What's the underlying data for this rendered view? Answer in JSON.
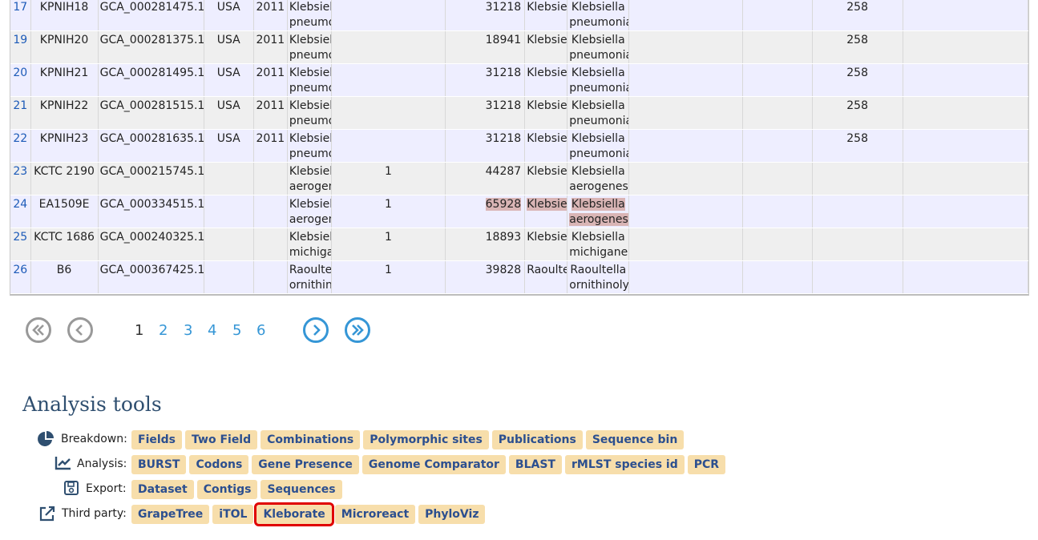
{
  "table": {
    "rows": [
      {
        "id": "17",
        "isolate": "KPNIH18",
        "assembly": "GCA_000281475.1",
        "country": "USA",
        "year": "2011",
        "species": "Klebsiella pneumoniae",
        "c7": "",
        "taxid": "31218",
        "genus": "Klebsiella",
        "species2": "Klebsiella pneumoniae",
        "c11": "",
        "c12": "",
        "st": "258"
      },
      {
        "id": "19",
        "isolate": "KPNIH20",
        "assembly": "GCA_000281375.1",
        "country": "USA",
        "year": "2011",
        "species": "Klebsiella pneumoniae",
        "c7": "",
        "taxid": "18941",
        "genus": "Klebsiella",
        "species2": "Klebsiella pneumoniae",
        "c11": "",
        "c12": "",
        "st": "258"
      },
      {
        "id": "20",
        "isolate": "KPNIH21",
        "assembly": "GCA_000281495.1",
        "country": "USA",
        "year": "2011",
        "species": "Klebsiella pneumoniae",
        "c7": "",
        "taxid": "31218",
        "genus": "Klebsiella",
        "species2": "Klebsiella pneumoniae",
        "c11": "",
        "c12": "",
        "st": "258"
      },
      {
        "id": "21",
        "isolate": "KPNIH22",
        "assembly": "GCA_000281515.1",
        "country": "USA",
        "year": "2011",
        "species": "Klebsiella pneumoniae",
        "c7": "",
        "taxid": "31218",
        "genus": "Klebsiella",
        "species2": "Klebsiella pneumoniae",
        "c11": "",
        "c12": "",
        "st": "258"
      },
      {
        "id": "22",
        "isolate": "KPNIH23",
        "assembly": "GCA_000281635.1",
        "country": "USA",
        "year": "2011",
        "species": "Klebsiella pneumoniae",
        "c7": "",
        "taxid": "31218",
        "genus": "Klebsiella",
        "species2": "Klebsiella pneumoniae",
        "c11": "",
        "c12": "",
        "st": "258"
      },
      {
        "id": "23",
        "isolate": "KCTC 2190",
        "assembly": "GCA_000215745.1",
        "country": "",
        "year": "",
        "species": "Klebsiella aerogenes",
        "c7": "1",
        "taxid": "44287",
        "genus": "Klebsiella",
        "species2": "Klebsiella aerogenes",
        "c11": "",
        "c12": "",
        "st": ""
      },
      {
        "id": "24",
        "isolate": "EA1509E",
        "assembly": "GCA_000334515.1",
        "country": "",
        "year": "",
        "species": "Klebsiella aerogenes",
        "c7": "1",
        "taxid": "65928",
        "genus": "Klebsiella",
        "species2": "Klebsiella aerogenes",
        "c11": "",
        "c12": "",
        "st": ""
      },
      {
        "id": "25",
        "isolate": "KCTC 1686",
        "assembly": "GCA_000240325.1",
        "country": "",
        "year": "",
        "species": "Klebsiella michiganensis",
        "c7": "1",
        "taxid": "18893",
        "genus": "Klebsiella",
        "species2": "Klebsiella michiganensis",
        "c11": "",
        "c12": "",
        "st": ""
      },
      {
        "id": "26",
        "isolate": "B6",
        "assembly": "GCA_000367425.1",
        "country": "",
        "year": "",
        "species": "Raoultella ornithinolytica",
        "c7": "1",
        "taxid": "39828",
        "genus": "Raoultella",
        "species2": "Raoultella ornithinolytica",
        "c11": "",
        "c12": "",
        "st": ""
      }
    ],
    "highlight_row_index": 6
  },
  "pager": {
    "pages": [
      "1",
      "2",
      "3",
      "4",
      "5",
      "6"
    ],
    "current": "1",
    "first_icon": "double-chevron-left-icon",
    "prev_icon": "chevron-left-icon",
    "next_icon": "chevron-right-icon",
    "last_icon": "double-chevron-right-icon"
  },
  "analysis": {
    "title": "Analysis tools",
    "rows": [
      {
        "label": "Breakdown:",
        "icon": "pie-chart-icon",
        "buttons": [
          "Fields",
          "Two Field",
          "Combinations",
          "Polymorphic sites",
          "Publications",
          "Sequence bin"
        ]
      },
      {
        "label": "Analysis:",
        "icon": "line-chart-icon",
        "buttons": [
          "BURST",
          "Codons",
          "Gene Presence",
          "Genome Comparator",
          "BLAST",
          "rMLST species id",
          "PCR"
        ]
      },
      {
        "label": "Export:",
        "icon": "save-icon",
        "buttons": [
          "Dataset",
          "Contigs",
          "Sequences"
        ]
      },
      {
        "label": "Third party:",
        "icon": "external-link-icon",
        "buttons": [
          "GrapeTree",
          "iTOL",
          "Kleborate",
          "Microreact",
          "PhyloViz"
        ]
      }
    ],
    "selected_button": "Kleborate"
  },
  "colors": {
    "link": "#1d5bb8",
    "pager_active": "#3596d6",
    "button_bg": "#f7deab",
    "button_text": "#2c4f8f",
    "highlight": "#d9b5b5",
    "selected_outline": "#e00000"
  }
}
